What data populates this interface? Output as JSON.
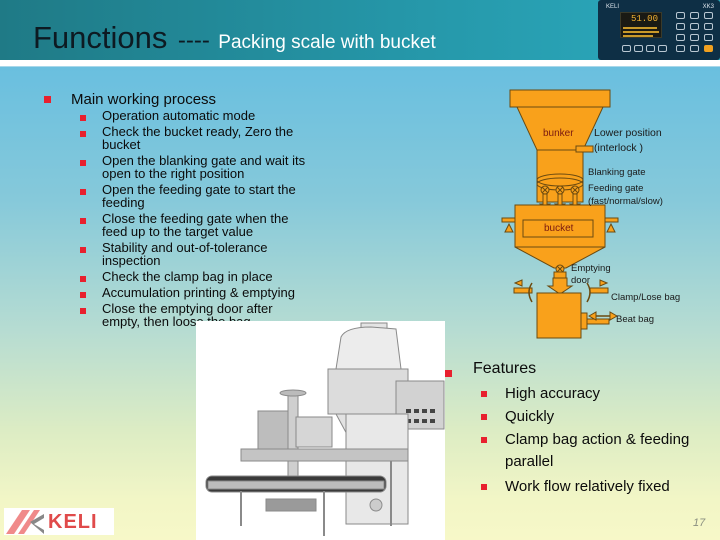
{
  "header": {
    "title": "Functions",
    "separator": "----",
    "subtitle": "Packing scale with  bucket"
  },
  "device": {
    "brand": "KELI",
    "model": "XK3",
    "readout": "51.00"
  },
  "process": {
    "heading": "Main working process",
    "steps": [
      [
        "Operation automatic mode"
      ],
      [
        "Check the bucket ready, Zero the",
        "bucket"
      ],
      [
        "Open the blanking gate and wait its",
        "open to the right position"
      ],
      [
        "Open the feeding gate to start the",
        "feeding"
      ],
      [
        "Close the feeding gate when the",
        "feed up to the target value"
      ],
      [
        "Stability and out-of-tolerance",
        "inspection"
      ],
      [
        "Check the clamp bag in place"
      ],
      [
        "Accumulation printing & emptying"
      ],
      [
        "Close the emptying door after",
        "empty, then loose the bag"
      ]
    ]
  },
  "diagram": {
    "bunker": "bunker",
    "lower_position": "Lower position",
    "interlock": "(interlock )",
    "blanking_gate": "Blanking gate",
    "feeding_gate": "Feeding gate",
    "feeding_modes": "(fast/normal/slow)",
    "bucket": "bucket",
    "emptying": "Emptying",
    "door": "door",
    "clamp": "Clamp/Lose bag",
    "beat": "Beat bag",
    "colors": {
      "fill": "#f9a11b",
      "stroke": "#6b4a10"
    }
  },
  "features": {
    "heading": "Features",
    "items": [
      [
        "High accuracy"
      ],
      [
        "Quickly"
      ],
      [
        "Clamp bag action & feeding",
        "parallel"
      ],
      [
        "Work flow relatively fixed"
      ]
    ]
  },
  "footer": {
    "logo_text": "KELI",
    "page_number": "17"
  },
  "colors": {
    "bullet": "#e8202e",
    "header": "#2596a8"
  }
}
